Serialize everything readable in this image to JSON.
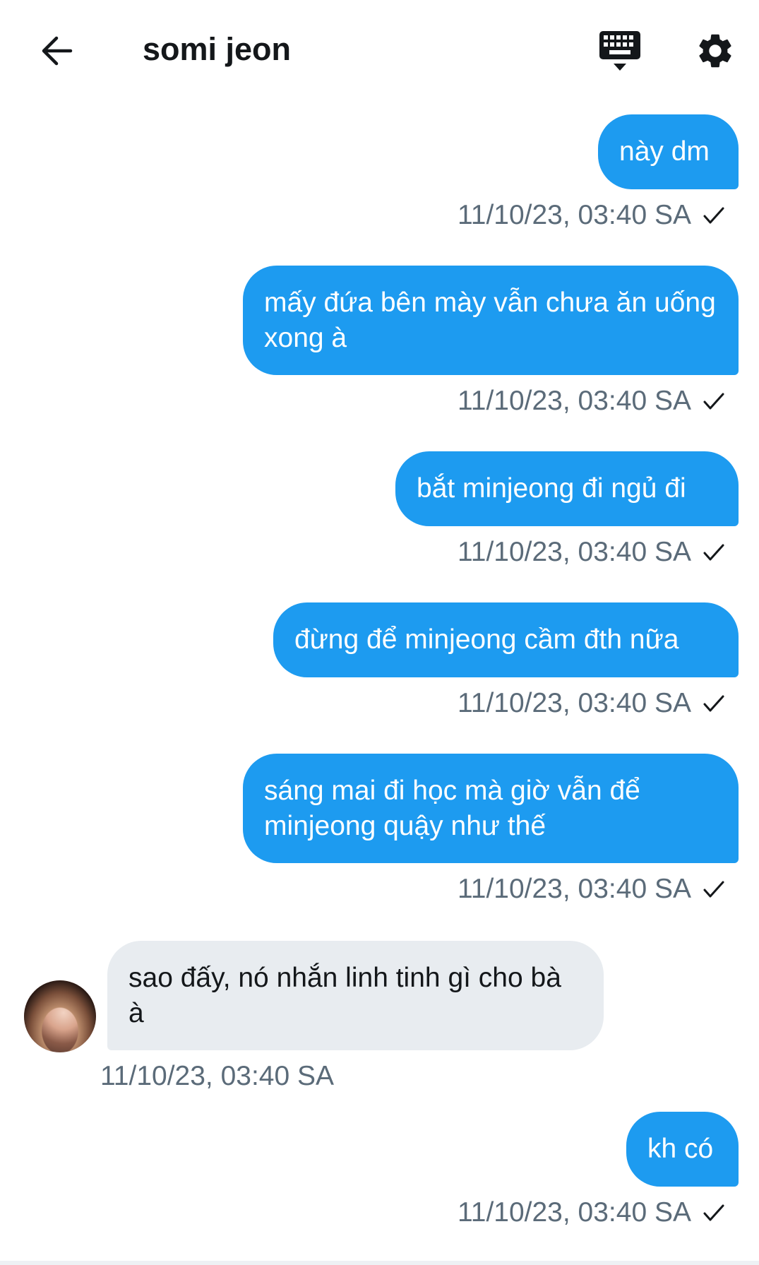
{
  "header": {
    "title": "somi jeon",
    "back_icon": "arrow-left-icon",
    "keyboard_icon": "keyboard-icon",
    "settings_icon": "gear-icon"
  },
  "colors": {
    "outgoing_bubble": "#1d9bf0",
    "incoming_bubble": "#e8ecf0",
    "timestamp": "#5b6b79"
  },
  "messages": [
    {
      "direction": "outgoing",
      "text": "này dm",
      "time": "11/10/23, 03:40 SA",
      "read": true
    },
    {
      "direction": "outgoing",
      "text": "mấy đứa bên mày vẫn chưa ăn uống xong à",
      "time": "11/10/23, 03:40 SA",
      "read": true
    },
    {
      "direction": "outgoing",
      "text": "bắt minjeong đi ngủ đi",
      "time": "11/10/23, 03:40 SA",
      "read": true
    },
    {
      "direction": "outgoing",
      "text": "đừng để minjeong cầm đth nữa",
      "time": "11/10/23, 03:40 SA",
      "read": true
    },
    {
      "direction": "outgoing",
      "text": "sáng mai đi học mà giờ vẫn để minjeong quậy như thế",
      "time": "11/10/23, 03:40 SA",
      "read": true
    },
    {
      "direction": "incoming",
      "text": "sao đấy, nó nhắn linh tinh gì cho bà à",
      "time": "11/10/23, 03:40 SA"
    },
    {
      "direction": "outgoing",
      "text": "kh có",
      "time": "11/10/23, 03:40 SA",
      "read": true
    }
  ]
}
